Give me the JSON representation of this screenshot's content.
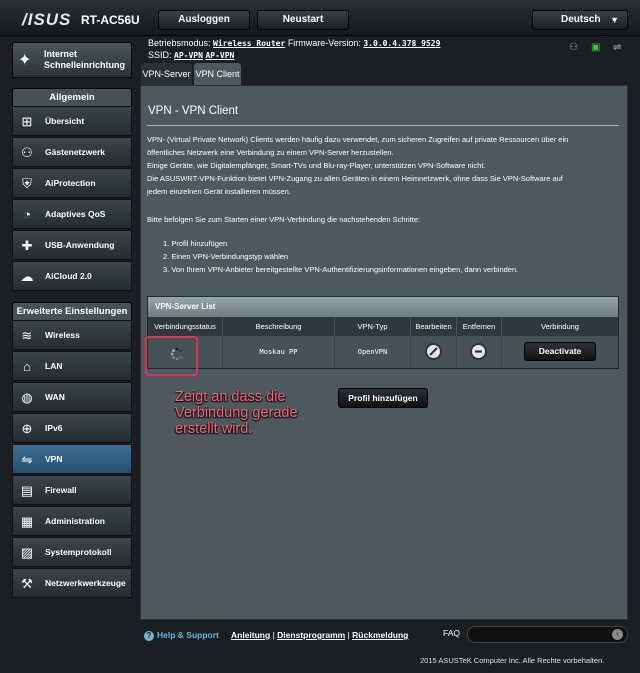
{
  "header": {
    "logo": "/ISUS",
    "model": "RT-AC56U",
    "logout_label": "Ausloggen",
    "restart_label": "Neustart",
    "language": "Deutsch"
  },
  "info": {
    "mode_label": "Betriebsmodus:",
    "mode_value": "Wireless Router",
    "fw_label": "Firmware-Version:",
    "fw_value": "3.0.0.4.378_9529",
    "ssid_label": "SSID:",
    "ssid_1": "AP-VPN",
    "ssid_2": "AP-VPN"
  },
  "sidebar": {
    "qis_label_1": "Internet",
    "qis_label_2": "Schnelleinrichtung",
    "general_header": "Allgemein",
    "general_items": [
      {
        "label": "Übersicht",
        "icon": "network-map-icon"
      },
      {
        "label": "Gästenetzwerk",
        "icon": "guest-network-icon"
      },
      {
        "label": "AiProtection",
        "icon": "shield-icon"
      },
      {
        "label": "Adaptives QoS",
        "icon": "speedometer-icon"
      },
      {
        "label": "USB-Anwendung",
        "icon": "puzzle-icon"
      },
      {
        "label": "AiCloud 2.0",
        "icon": "cloud-icon"
      }
    ],
    "advanced_header": "Erweiterte Einstellungen",
    "advanced_items": [
      {
        "label": "Wireless",
        "icon": "wifi-icon"
      },
      {
        "label": "LAN",
        "icon": "house-icon"
      },
      {
        "label": "WAN",
        "icon": "globe-icon"
      },
      {
        "label": "IPv6",
        "icon": "ipv6-icon"
      },
      {
        "label": "VPN",
        "icon": "vpn-icon"
      },
      {
        "label": "Firewall",
        "icon": "firewall-icon"
      },
      {
        "label": "Administration",
        "icon": "admin-icon"
      },
      {
        "label": "Systemprotokoll",
        "icon": "log-icon"
      },
      {
        "label": "Netzwerkwerkzeuge",
        "icon": "tools-icon"
      }
    ]
  },
  "tabs": [
    {
      "label": "VPN-Server"
    },
    {
      "label": "VPN Client"
    }
  ],
  "main": {
    "title": "VPN - VPN Client",
    "para1_line1": "VPN- (Virtual Private Network) Clients werden häufig dazu verwendet, zum sicheren Zugreifen auf private Ressourcen über ein",
    "para1_line2": "öffentliches Netzwerk eine Verbindung zu einem VPN-Server herzustellen.",
    "para1_line3": "Einige Geräte, wie Digitalempfänger, Smart-TVs und Blu-ray-Player, unterstützen VPN-Software nicht.",
    "para1_line4": "Die ASUSWRT-VPN-Funktion bietet VPN-Zugang zu allen Geräten in einem Heimnetzwerk, ohne dass Sie VPN-Software auf",
    "para1_line5": "jedem einzelnen Gerät installieren müssen.",
    "steps_intro": "Bitte befolgen Sie zum Starten einer VPN-Verbindung die nachstehenden Schritte:",
    "steps": [
      "1. Profil hinzufügen",
      "2. Einen VPN-Verbindungstyp wählen",
      "3. Von Ihrem VPN-Anbieter bereitgestellte VPN-Authentifizierungsinformationen eingeben, dann verbinden."
    ],
    "table_title": "VPN-Server List",
    "columns": [
      "Verbindungsstatus",
      "Beschreibung",
      "VPN-Typ",
      "Bearbeiten",
      "Entfernen",
      "Verbindung"
    ],
    "row": {
      "description": "Moskau PP",
      "type": "OpenVPN",
      "action": "Deactivate"
    },
    "callout_line1": "Zeigt an dass die",
    "callout_line2": "Verbindung gerade",
    "callout_line3": "erstellt wird.",
    "add_profile": "Profil hinzufügen"
  },
  "footer": {
    "help": "Help & Support",
    "link1": "Anleitung",
    "sep": "|",
    "link2": "Dienstprogramm",
    "link3": "Rückmeldung",
    "faq": "FAQ",
    "copyright": "2015 ASUSTeK Computer Inc. Alle Rechte vorbehalten."
  },
  "colors": {
    "highlight": "#e0305a",
    "callout": "#f4607f",
    "active_nav": "#3f6f93",
    "panel": "#4d595d"
  }
}
